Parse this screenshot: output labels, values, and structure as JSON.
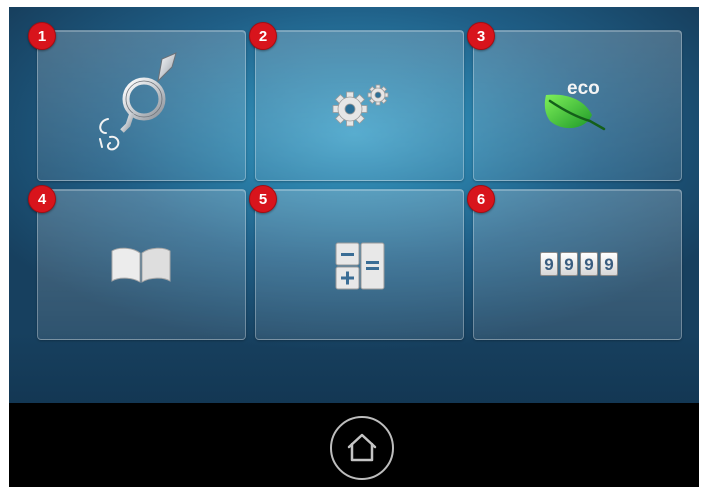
{
  "tiles": [
    {
      "number": "1",
      "name": "Thread / stitch settings",
      "icon": "needle-thread-icon"
    },
    {
      "number": "2",
      "name": "Settings",
      "icon": "gears-icon"
    },
    {
      "number": "3",
      "name": "Eco mode",
      "icon": "eco-leaf-icon",
      "label": "eco"
    },
    {
      "number": "4",
      "name": "Guide",
      "icon": "book-icon"
    },
    {
      "number": "5",
      "name": "Calculator",
      "icon": "calculator-icon"
    },
    {
      "number": "6",
      "name": "Counter",
      "icon": "counter-icon",
      "digits": [
        "9",
        "9",
        "9",
        "9"
      ]
    }
  ],
  "colors": {
    "badge": "#d8141c",
    "leaf": "#3cc43a",
    "background_center": "#3ea0c8",
    "background_edge": "#17405f"
  },
  "home": {
    "icon": "home-icon"
  }
}
